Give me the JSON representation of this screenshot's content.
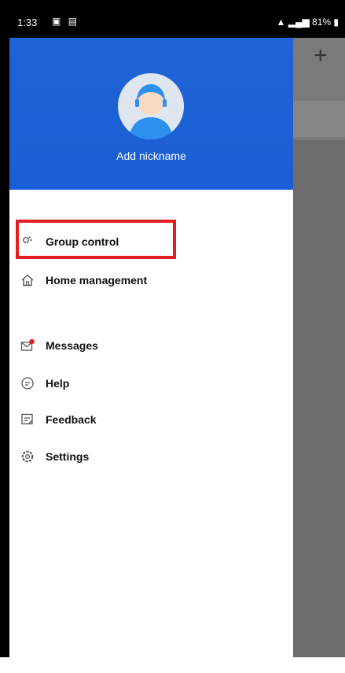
{
  "status_bar": {
    "time": "1:33",
    "left_icons": "▣ ▤",
    "right_text": "81%"
  },
  "drawer": {
    "profile": {
      "nickname": "Add nickname"
    },
    "menu": [
      {
        "label": "Group control",
        "icon": "group-control-icon"
      },
      {
        "label": "Home management",
        "icon": "home-icon",
        "highlighted": true
      },
      {
        "label": "Messages",
        "icon": "messages-icon",
        "badge_color": "#e02020"
      },
      {
        "label": "Help",
        "icon": "help-icon"
      },
      {
        "label": "Feedback",
        "icon": "feedback-icon"
      },
      {
        "label": "Settings",
        "icon": "settings-icon"
      }
    ]
  },
  "background_screen": {
    "add_button": "+"
  },
  "colors": {
    "header_blue": "#1f63d6",
    "highlight_red": "#e02020",
    "overlay_gray": "#6d6d6d"
  }
}
